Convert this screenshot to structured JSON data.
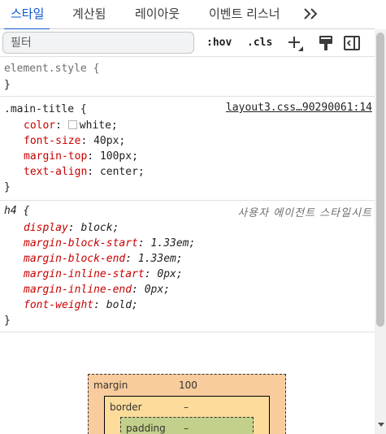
{
  "tabs": [
    {
      "label": "스타일",
      "active": true
    },
    {
      "label": "계산됨",
      "active": false
    },
    {
      "label": "레이아웃",
      "active": false
    },
    {
      "label": "이벤트 리스너",
      "active": false
    }
  ],
  "tabs_more_icon": "double-chevron-right-icon",
  "toolbar": {
    "filter_placeholder": "필터",
    "hov_label": ":hov",
    "cls_label": ".cls",
    "icons": [
      "new-style-rule-icon",
      "paint-brush-icon",
      "toggle-sidebar-icon"
    ]
  },
  "rules": {
    "element_style": {
      "selector": "element.style {",
      "close": "}"
    },
    "main_title": {
      "selector": ".main-title {",
      "source": "layout3.css…90290061:14",
      "declarations": [
        {
          "prop": "color",
          "value": "white;",
          "swatch": "#ffffff"
        },
        {
          "prop": "font-size",
          "value": "40px;"
        },
        {
          "prop": "margin-top",
          "value": "100px;"
        },
        {
          "prop": "text-align",
          "value": "center;"
        }
      ],
      "close": "}"
    },
    "h4": {
      "selector": "h4 {",
      "source": "사용자 에이전트 스타일시트",
      "declarations": [
        {
          "prop": "display",
          "value": "block;"
        },
        {
          "prop": "margin-block-start",
          "value": "1.33em;"
        },
        {
          "prop": "margin-block-end",
          "value": "1.33em;"
        },
        {
          "prop": "margin-inline-start",
          "value": "0px;"
        },
        {
          "prop": "margin-inline-end",
          "value": "0px;"
        },
        {
          "prop": "font-weight",
          "value": "bold;"
        }
      ],
      "close": "}"
    }
  },
  "box_model": {
    "margin_label": "margin",
    "margin_top": "100",
    "border_label": "border",
    "border_value": "–",
    "padding_label": "padding",
    "padding_value": "–"
  },
  "colors": {
    "accent": "#0b57d0",
    "property": "#c80000",
    "margin_box": "#f9cc9d",
    "border_box": "#fcdb9b",
    "padding_box": "#c3d08b"
  }
}
